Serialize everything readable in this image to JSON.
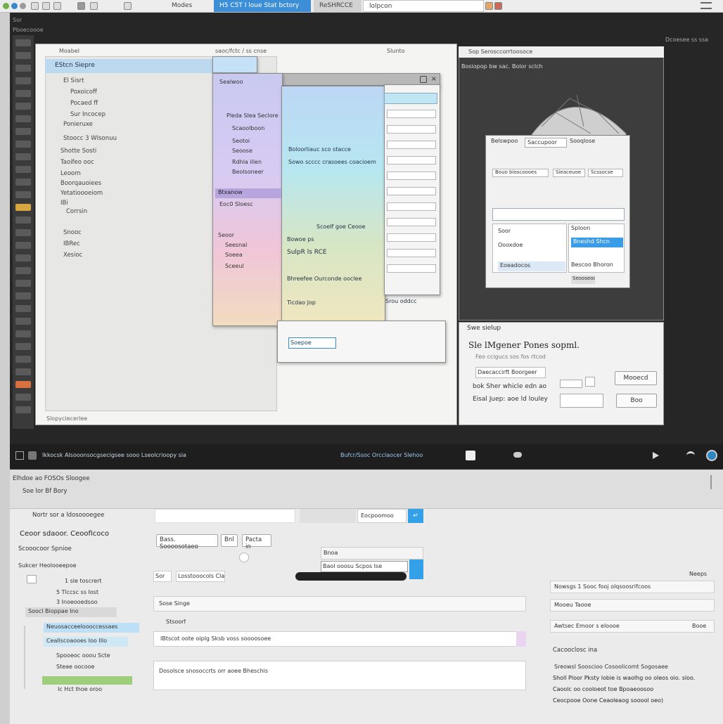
{
  "browser": {
    "tabs": [
      "Modes",
      "H5 C5T I loue Stat bctory",
      "ReSHRCCE",
      "lolpcon"
    ],
    "icons": [
      "circle-green",
      "circle-blue",
      "circle-gray",
      "folder-icon",
      "monitor-icon",
      "settings-icon"
    ]
  },
  "canvas": {
    "header_left": "Moabel",
    "header_mid": "saoc/fctc / ss cnse",
    "header_right": "Slunto",
    "selected_item": "EStcn Siepre",
    "tree": [
      "El Sisrt",
      "Poxoicoff",
      "Pocaed ff",
      "Sur Incocep",
      "Ponieruxe",
      "Stoocc 3 WIsonuu",
      "Shotte Sosti",
      "Taoifeo ooc",
      "Leoorn",
      "Boorqauoiees",
      "Yetatioooeiom",
      "IBi",
      "Corrsin",
      "Snooc",
      "IBRec",
      "Xesioc"
    ],
    "footer": "Slopyciecerlee"
  },
  "dialogs": {
    "menu": [
      "Sealwoo",
      "Pleda Slea Seclore",
      "Scaoolboon",
      "Seotoi",
      "Seoose",
      "Rdhla illen",
      "Beolsoneer",
      "Btxanow",
      "Eoc0 Sloesc",
      "Seoor",
      "Seesnal",
      "Soeea",
      "Sceeul"
    ],
    "panel_text": [
      "Boloorliauc sco stacce",
      "Sowo scccc crasoees coacioem",
      "Scoelf goe Ceooe",
      "Bowoe ps",
      "SulpR ls RCE",
      "Bhreefee Ourconde ooclee",
      "Ticdao Jop",
      "Srou oddcc"
    ],
    "form_btn": "Soepoe"
  },
  "preview": {
    "header": "Sop Serosccorrtoosoce",
    "subtitle": "Bosiopop bw sac. Bolor sclch",
    "dlg_title": "Belswpoo",
    "dlg_tabs": [
      "Saccupoor",
      "Sooqlose"
    ],
    "dlg_fields": [
      "Bouo bioscoooes",
      "Sieaceuoe",
      "Scssocse"
    ],
    "dlg_list": [
      "Sploon",
      "Soor",
      "Oooxdoe",
      "Bneshd Shcn",
      "Eoeadocos",
      "Bescoo Bhoron"
    ],
    "footer": "Seooseoo"
  },
  "settings": {
    "title": "Swe sielup",
    "line1": "Sle lMgener Pones sopml.",
    "line2": "Feo ccigucs sos fos rtcod",
    "field_label": "Daecaccirft Boorgeer",
    "row1": "bok Sher whicle edn ao",
    "row2": "Eisal Juep: aoe ld louley",
    "button_a": "Mooecd",
    "button_b": "Boo"
  },
  "statusbar": {
    "left": "Ikkocsk Alsooonsocgsecigsee sooo Lseolcrioopy sia",
    "middle": "Bufcr/Ssoc   Orcclaocer Slehoo",
    "icons": [
      "terminal-icon",
      "chat-icon",
      "cloud-icon",
      "play-icon",
      "wifi-icon",
      "globe-icon"
    ]
  },
  "lower": {
    "title": "Elhdoe ao FOSOs Sloogee",
    "subtitle": "Soe lor Bf Bory",
    "section1": "Nortr sor a ldosoooegee",
    "search_placeholder": "Eocpoomoo",
    "nav": [
      "Ceoor sdaoor. Ceooficoco",
      "Scooocoor Spnioe",
      "Sukcer Heolooeepoe"
    ],
    "nav_items": [
      "1 sle toscrert",
      "5 Tlccsc ss lost",
      "3 Inoeooedsoo",
      "Soocl Bioppae Ino",
      "Neuosacceeloooccessaes",
      "Ceallscoaooes Ioo Illo",
      "Spooeoc ooou Scte",
      "Steae oocooe",
      "Ic Hct Ihoe oroo"
    ],
    "chips": [
      "Bass. Soooosotaeo",
      "Bnl",
      "Pacta in"
    ],
    "dropdown": [
      "Bnoa",
      "Baol ooosu Scpos Ise"
    ],
    "field_label": "Sor",
    "field_value": "Losstooocols Cla 330",
    "section_a": "Sose Singe",
    "section_b": "Stsoorf",
    "row_text": "IBtscot oote oiplg Sksb voss soooosoee",
    "desc": "Dosolsce snosoccrts orr aoee Bheschis",
    "right_header": "Neeps",
    "right_rows": [
      "Nowsgs 1 Sooc fooj olqsoosrifcoos",
      "Mooeu Taooe",
      "Awtsec Emoor s eloooe"
    ],
    "right_row_tail": "Booe",
    "right_section": "Cacooclosc ina",
    "right_text": [
      "Sreowsl Sooscioo Cosoolicomt     Sogosaee",
      "Sholl Ploor Pksty lobie is waolhg oo oleos oio. sloo.",
      "Caoolc oo cooloeot toe Bpoaeoosoo",
      "Ceocpooe Oone Ceaoleaog sooool oeo)"
    ]
  }
}
